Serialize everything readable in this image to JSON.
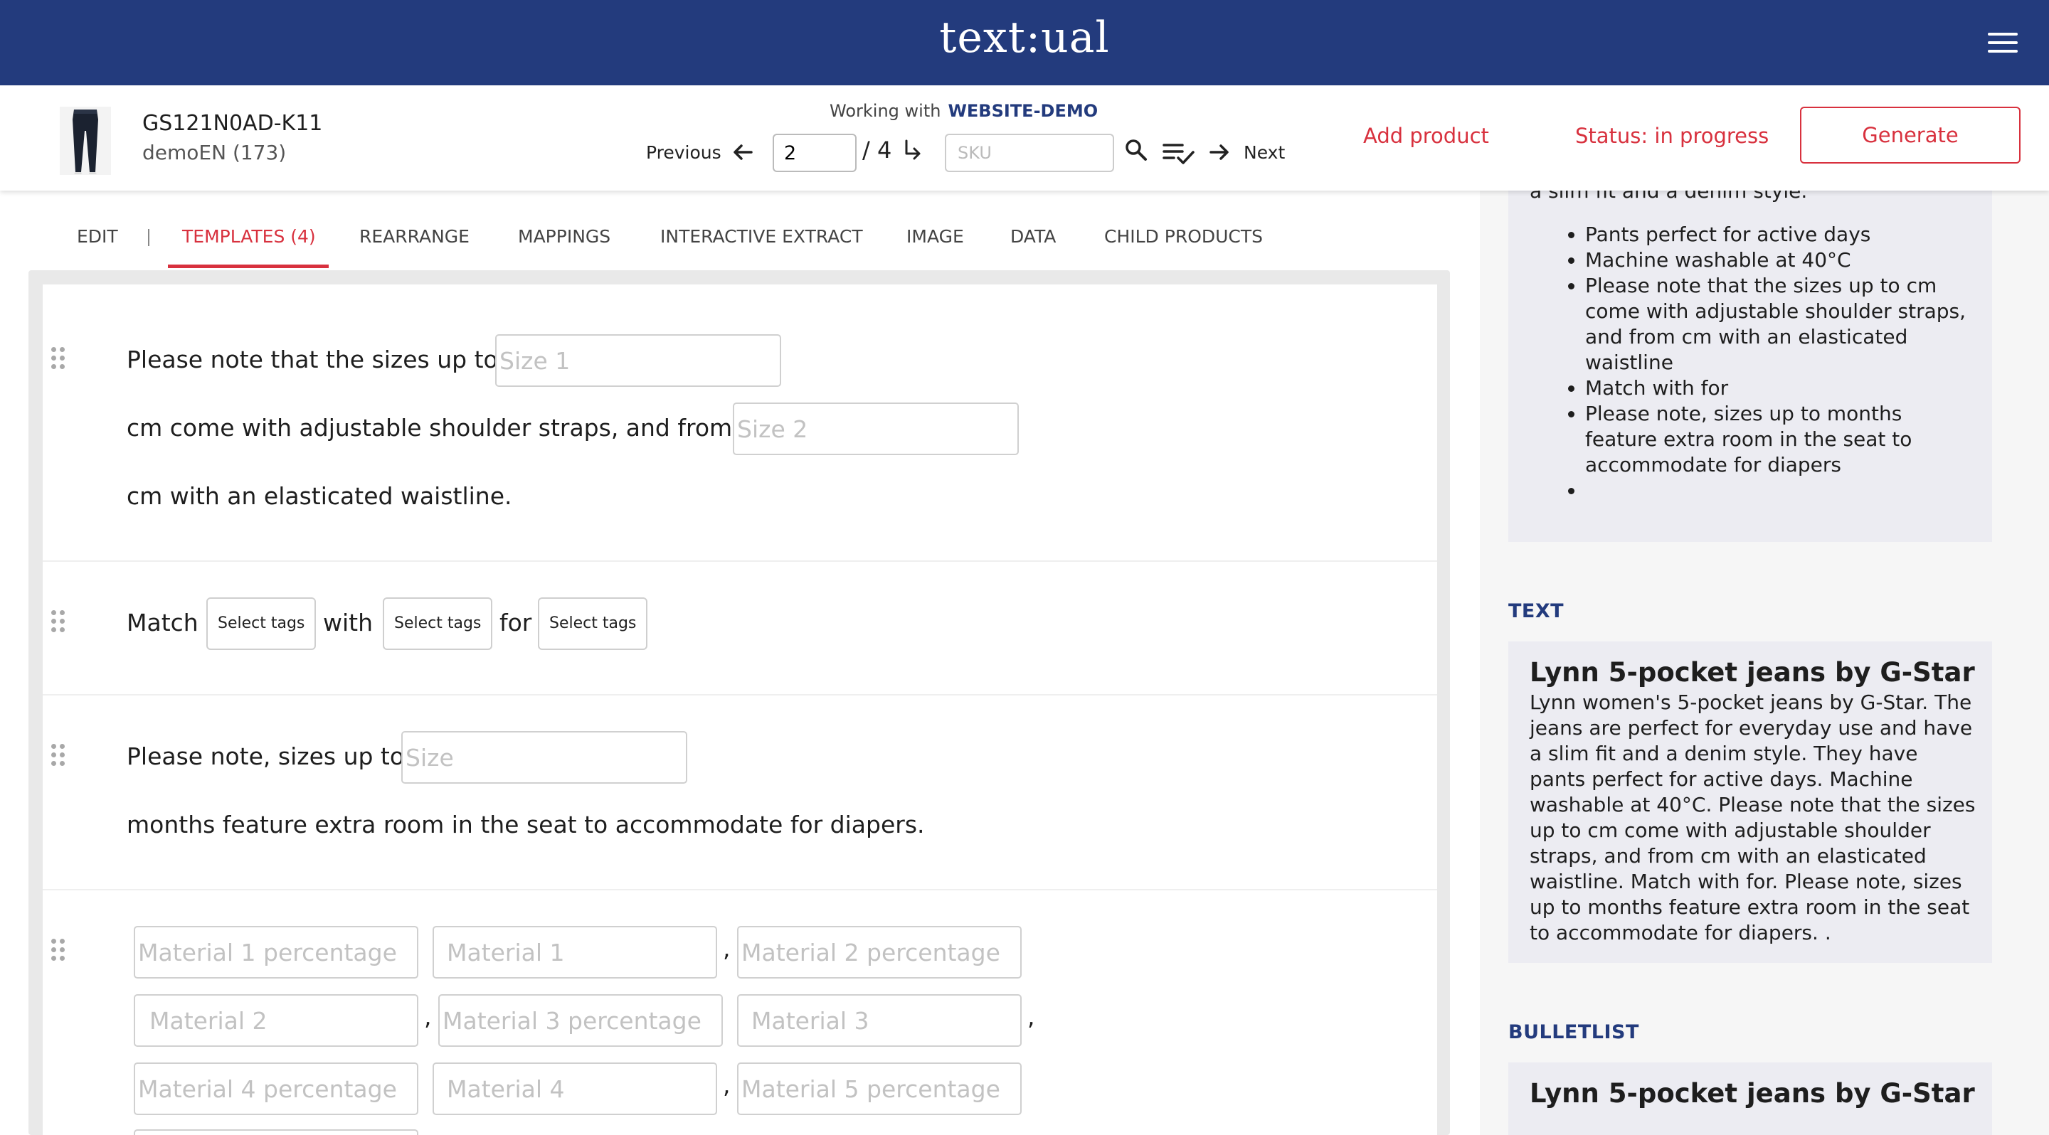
{
  "app": {
    "logo": "text:ual"
  },
  "header": {
    "sku": "GS121N0AD-K11",
    "subtitle": "demoEN (173)",
    "working_with_label": "Working with",
    "working_with_value": "WEBSITE-DEMO",
    "previous_label": "Previous",
    "page_value": "2",
    "page_total": "/ 4",
    "sku_placeholder": "SKU",
    "next_label": "Next",
    "add_product": "Add product",
    "status": "Status: in progress",
    "generate": "Generate"
  },
  "tabs": [
    {
      "label": "EDIT"
    },
    {
      "label": "TEMPLATES (4)",
      "active": true
    },
    {
      "label": "REARRANGE"
    },
    {
      "label": "MAPPINGS"
    },
    {
      "label": "INTERACTIVE EXTRACT"
    },
    {
      "label": "IMAGE"
    },
    {
      "label": "DATA"
    },
    {
      "label": "CHILD PRODUCTS"
    }
  ],
  "tab_separator": "|",
  "templates": {
    "t1": {
      "text1": "Please note that the sizes up to",
      "ph1": "Size 1",
      "text2": "cm come with adjustable shoulder straps, and from",
      "ph2": "Size 2",
      "text3": "cm with an elasticated waistline."
    },
    "t2": {
      "text1": "Match",
      "tag1": "Select tags",
      "text2": "with",
      "tag2": "Select tags",
      "text3": "for",
      "tag3": "Select tags"
    },
    "t3": {
      "text1": "Please note, sizes up to",
      "ph1": "Size",
      "text2": "months feature extra room in the seat to accommodate for diapers."
    },
    "t4": {
      "ph_m1p": "Material 1 percentage",
      "ph_m1": "Material 1",
      "ph_m2p": "Material 2 percentage",
      "ph_m2": "Material 2",
      "ph_m3p": "Material 3 percentage",
      "ph_m3": "Material 3",
      "ph_m4p": "Material 4 percentage",
      "ph_m4": "Material 4",
      "ph_m5p": "Material 5 percentage",
      "comma": ","
    }
  },
  "preview": {
    "cutoff_text": "a slim fit and a denim style.",
    "bullets": [
      "Pants perfect for active days",
      "Machine washable at 40°C",
      "Please note that the sizes up to cm come with adjustable shoulder straps, and from cm with an elasticated waistline",
      "Match with for",
      "Please note, sizes up to months feature extra room in the seat to accommodate for diapers",
      ""
    ],
    "text_section_title": "TEXT",
    "text_heading": "Lynn 5-pocket jeans by G-Star",
    "text_body": "Lynn women's 5-pocket jeans by G-Star. The jeans are perfect for everyday use and have a slim fit and a denim style. They have pants perfect for active days. Machine washable at 40°C. Please note that the sizes up to cm come with adjustable shoulder straps, and from cm with an elasticated waistline. Match with for. Please note, sizes up to months feature extra room in the seat to accommodate for diapers. .",
    "bulletlist_section_title": "BULLETLIST",
    "bulletlist_heading": "Lynn 5-pocket jeans by G-Star"
  },
  "colors": {
    "brand": "#233b7d",
    "accent": "#d8313e"
  }
}
